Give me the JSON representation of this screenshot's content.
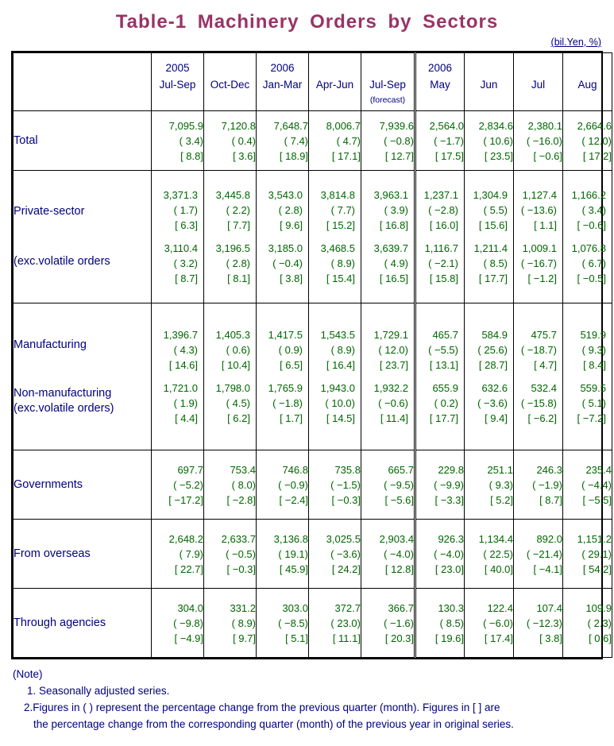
{
  "title": "Table-1  Machinery  Orders  by  Sectors",
  "unit_caption": "(bil.Yen, %)",
  "colors": {
    "title": "#993366",
    "label": "#000080",
    "value": "#006600",
    "border": "#000000"
  },
  "header": {
    "blank_label": "",
    "columns": [
      {
        "year": "2005",
        "period": "Jul-Sep",
        "note": ""
      },
      {
        "year": "",
        "period": "Oct-Dec",
        "note": ""
      },
      {
        "year": "2006",
        "period": "Jan-Mar",
        "note": ""
      },
      {
        "year": "",
        "period": "Apr-Jun",
        "note": ""
      },
      {
        "year": "",
        "period": "Jul-Sep",
        "note": "(forecast)"
      },
      {
        "year": "2006",
        "period": "May",
        "note": ""
      },
      {
        "year": "",
        "period": "Jun",
        "note": ""
      },
      {
        "year": "",
        "period": "Jul",
        "note": ""
      },
      {
        "year": "",
        "period": "Aug",
        "note": ""
      }
    ]
  },
  "rows": [
    {
      "id": "total",
      "label_lines": [
        "Total"
      ],
      "indent": 0,
      "series": [
        {
          "values": [
            "7,095.9",
            "7,120.8",
            "7,648.7",
            "8,006.7",
            "7,939.6",
            "2,564.0",
            "2,834.6",
            "2,380.1",
            "2,664.6"
          ],
          "paren": [
            "( 3.4)",
            "( 0.4)",
            "( 7.4)",
            "( 4.7)",
            "( −0.8)",
            "( −1.7)",
            "( 10.6)",
            "( −16.0)",
            "( 12.0)"
          ],
          "bracket": [
            "[ 8.8]",
            "[ 3.6]",
            "[ 18.9]",
            "[ 17.1]",
            "[ 12.7]",
            "[ 17.5]",
            "[ 23.5]",
            "[ −0.6]",
            "[ 17.2]"
          ]
        }
      ]
    },
    {
      "id": "private-sector",
      "label_lines": [
        "Private-sector",
        "(exc.volatile orders"
      ],
      "indent": 1,
      "series": [
        {
          "values": [
            "3,371.3",
            "3,445.8",
            "3,543.0",
            "3,814.8",
            "3,963.1",
            "1,237.1",
            "1,304.9",
            "1,127.4",
            "1,166.2"
          ],
          "paren": [
            "( 1.7)",
            "( 2.2)",
            "( 2.8)",
            "( 7.7)",
            "( 3.9)",
            "( −2.8)",
            "( 5.5)",
            "( −13.6)",
            "( 3.4)"
          ],
          "bracket": [
            "[ 6.3]",
            "[ 7.7]",
            "[ 9.6]",
            "[ 15.2]",
            "[ 16.8]",
            "[ 16.0]",
            "[ 15.6]",
            "[ 1.1]",
            "[ −0.6]"
          ]
        },
        {
          "values": [
            "3,110.4",
            "3,196.5",
            "3,185.0",
            "3,468.5",
            "3,639.7",
            "1,116.7",
            "1,211.4",
            "1,009.1",
            "1,076.8"
          ],
          "paren": [
            "( 3.2)",
            "( 2.8)",
            "( −0.4)",
            "( 8.9)",
            "( 4.9)",
            "( −2.1)",
            "( 8.5)",
            "( −16.7)",
            "( 6.7)"
          ],
          "bracket": [
            "[ 8.7]",
            "[ 8.1]",
            "[ 3.8]",
            "[ 15.4]",
            "[ 16.5]",
            "[ 15.8]",
            "[ 17.7]",
            "[ −1.2]",
            "[ −0.5]"
          ]
        }
      ]
    },
    {
      "id": "manufacturing-group",
      "label_lines": [
        "Manufacturing",
        "Non-manufacturing",
        "(exc.volatile orders)"
      ],
      "indent": 2,
      "series": [
        {
          "values": [
            "1,396.7",
            "1,405.3",
            "1,417.5",
            "1,543.5",
            "1,729.1",
            "465.7",
            "584.9",
            "475.7",
            "519.9"
          ],
          "paren": [
            "( 4.3)",
            "( 0.6)",
            "( 0.9)",
            "( 8.9)",
            "( 12.0)",
            "( −5.5)",
            "( 25.6)",
            "( −18.7)",
            "( 9.3)"
          ],
          "bracket": [
            "[ 14.6]",
            "[ 10.4]",
            "[ 6.5]",
            "[ 16.4]",
            "[ 23.7]",
            "[ 13.1]",
            "[ 28.7]",
            "[ 4.7]",
            "[ 8.4]"
          ]
        },
        {
          "values": [
            "1,721.0",
            "1,798.0",
            "1,765.9",
            "1,943.0",
            "1,932.2",
            "655.9",
            "632.6",
            "532.4",
            "559.5"
          ],
          "paren": [
            "( 1.9)",
            "( 4.5)",
            "( −1.8)",
            "( 10.0)",
            "( −0.6)",
            "( 0.2)",
            "( −3.6)",
            "( −15.8)",
            "( 5.1)"
          ],
          "bracket": [
            "[ 4.4]",
            "[ 6.2]",
            "[ 1.7]",
            "[ 14.5]",
            "[ 11.4]",
            "[ 17.7]",
            "[ 9.4]",
            "[ −6.2]",
            "[ −7.2]"
          ]
        }
      ]
    },
    {
      "id": "governments",
      "label_lines": [
        "Governments"
      ],
      "indent": 1,
      "series": [
        {
          "values": [
            "697.7",
            "753.4",
            "746.8",
            "735.8",
            "665.7",
            "229.8",
            "251.1",
            "246.3",
            "235.4"
          ],
          "paren": [
            "( −5.2)",
            "( 8.0)",
            "( −0.9)",
            "( −1.5)",
            "( −9.5)",
            "( −9.9)",
            "( 9.3)",
            "( −1.9)",
            "( −4.4)"
          ],
          "bracket": [
            "[ −17.2]",
            "[ −2.8]",
            "[ −2.4]",
            "[ −0.3]",
            "[ −5.6]",
            "[ −3.3]",
            "[ 5.2]",
            "[ 8.7]",
            "[ −5.5]"
          ]
        }
      ]
    },
    {
      "id": "from-overseas",
      "label_lines": [
        "From overseas"
      ],
      "indent": 1,
      "series": [
        {
          "values": [
            "2,648.2",
            "2,633.7",
            "3,136.8",
            "3,025.5",
            "2,903.4",
            "926.3",
            "1,134.4",
            "892.0",
            "1,151.2"
          ],
          "paren": [
            "( 7.9)",
            "( −0.5)",
            "( 19.1)",
            "( −3.6)",
            "( −4.0)",
            "( −4.0)",
            "( 22.5)",
            "( −21.4)",
            "( 29.1)"
          ],
          "bracket": [
            "[ 22.7]",
            "[ −0.3]",
            "[ 45.9]",
            "[ 24.2]",
            "[ 12.8]",
            "[ 23.0]",
            "[ 40.0]",
            "[ −4.1]",
            "[ 54.2]"
          ]
        }
      ]
    },
    {
      "id": "through-agencies",
      "label_lines": [
        "Through agencies"
      ],
      "indent": 1,
      "series": [
        {
          "values": [
            "304.0",
            "331.2",
            "303.0",
            "372.7",
            "366.7",
            "130.3",
            "122.4",
            "107.4",
            "109.9"
          ],
          "paren": [
            "( −9.8)",
            "( 8.9)",
            "( −8.5)",
            "( 23.0)",
            "( −1.6)",
            "( 8.5)",
            "( −6.0)",
            "( −12.3)",
            "( 2.3)"
          ],
          "bracket": [
            "[ −4.9]",
            "[ 9.7]",
            "[ 5.1]",
            "[ 11.1]",
            "[ 20.3]",
            "[ 19.6]",
            "[ 17.4]",
            "[ 3.8]",
            "[ 0.6]"
          ]
        }
      ]
    }
  ],
  "notes": {
    "heading": "(Note)",
    "item1": "1. Seasonally adjusted series.",
    "item2_line1": "2.Figures in ( ) represent the percentage change from the previous quarter (month). Figures in [ ] are",
    "item2_line2": "the percentage change from the corresponding quarter (month) of the previous year in original series."
  }
}
